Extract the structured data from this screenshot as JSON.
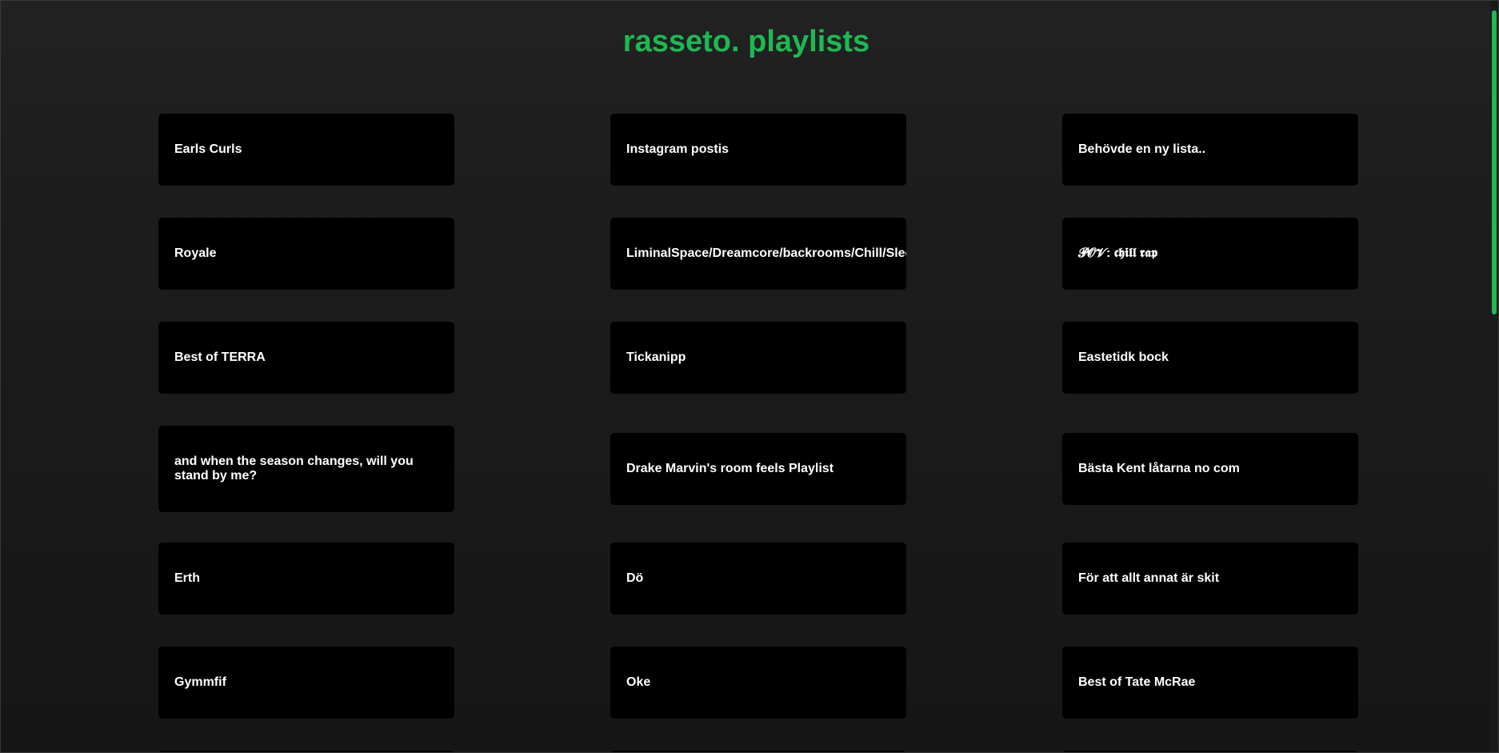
{
  "page": {
    "title": "rasseto. playlists"
  },
  "colors": {
    "accent": "#1db954",
    "card_bg": "#000000",
    "text": "#ffffff"
  },
  "playlists": [
    [
      "Earls Curls",
      "Instagram postis",
      "Behövde en ny lista.."
    ],
    [
      "Royale",
      "LiminalSpace/Dreamcore/backrooms/Chill/Sleep",
      "𝓟𝓞𝓥: 𝖈𝖍𝖎𝖑𝖑 𝖗𝖆𝖕"
    ],
    [
      "Best of TERRA",
      "Tickanipp",
      "Eastetidk bock"
    ],
    [
      "and when the season changes, will you stand by me?",
      "Drake Marvin's room feels Playlist",
      "Bästa Kent låtarna no com"
    ],
    [
      "Erth",
      "Dö",
      "För att allt annat är skit"
    ],
    [
      "Gymmfif",
      "Oke",
      "Best of Tate McRae"
    ]
  ]
}
